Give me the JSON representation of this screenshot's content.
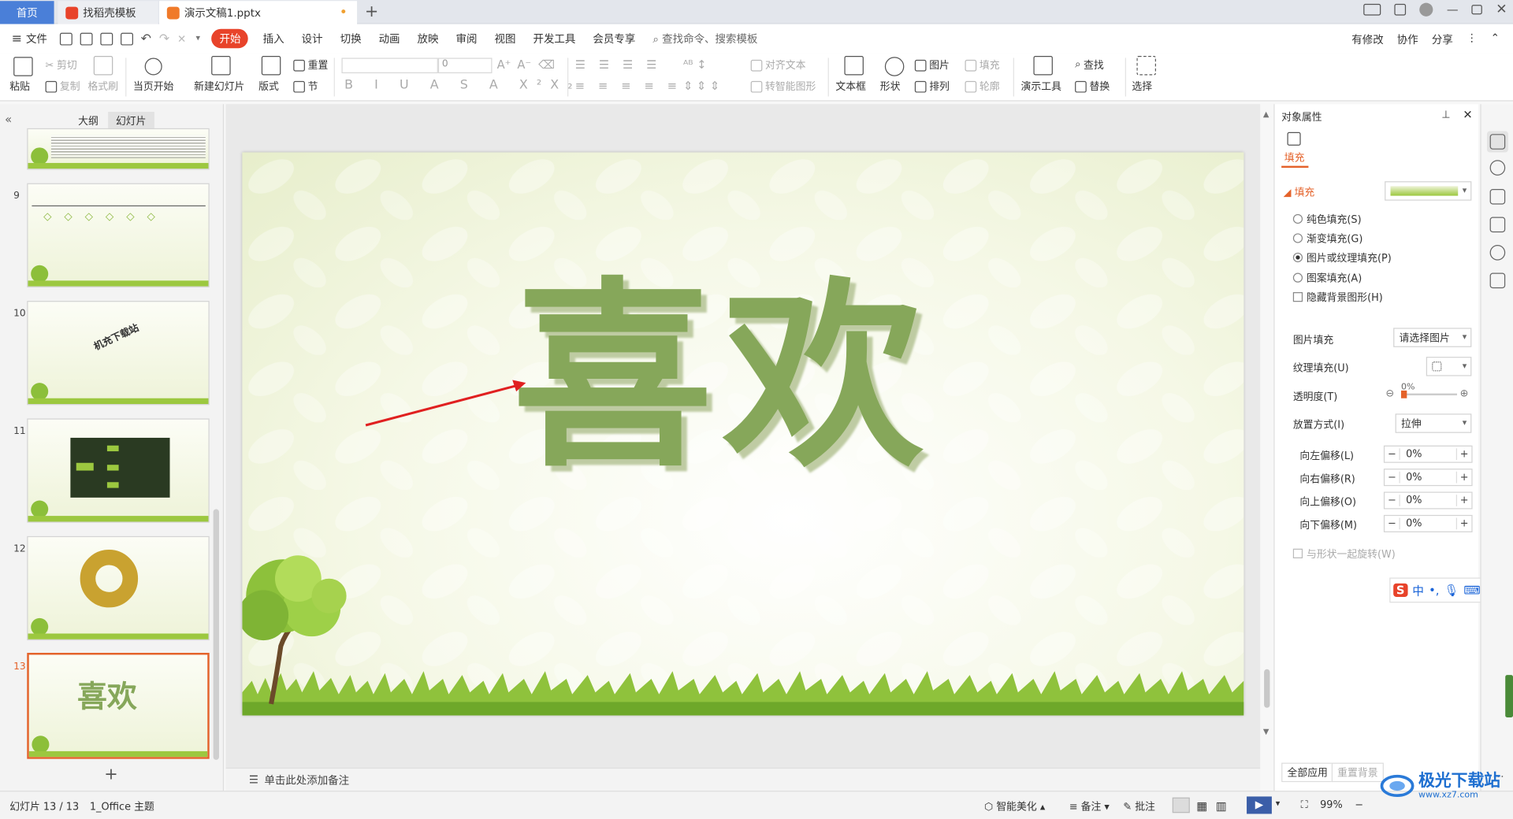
{
  "tabs": {
    "home": "首页",
    "template": "找稻壳模板",
    "doc": "演示文稿1.pptx"
  },
  "menu": {
    "file": "文件",
    "items": [
      "开始",
      "插入",
      "设计",
      "切换",
      "动画",
      "放映",
      "审阅",
      "视图",
      "开发工具",
      "会员专享"
    ],
    "search": "查找命令、搜索模板",
    "right": [
      "有修改",
      "协作",
      "分享"
    ]
  },
  "ribbon": {
    "paste": "粘贴",
    "cut": "剪切",
    "copy": "复制",
    "format_painter": "格式刷",
    "start_from_page": "当页开始",
    "new_slide": "新建幻灯片",
    "layout": "版式",
    "reset": "重置",
    "section": "节",
    "font_size": "0",
    "align_text": "对齐文本",
    "smart_shape": "转智能图形",
    "textbox": "文本框",
    "shape": "形状",
    "picture": "图片",
    "arrange": "排列",
    "fill": "填充",
    "outline": "轮廓",
    "presentation_tools": "演示工具",
    "find": "查找",
    "replace": "替换",
    "select": "选择"
  },
  "left": {
    "tab_outline": "大纲",
    "tab_slides": "幻灯片",
    "thumbs": [
      {
        "num": "",
        "kind": "text"
      },
      {
        "num": "9",
        "kind": "timeline"
      },
      {
        "num": "10",
        "kind": "wordart",
        "text": "机充下载站"
      },
      {
        "num": "11",
        "kind": "mindmap"
      },
      {
        "num": "12",
        "kind": "ring"
      },
      {
        "num": "13",
        "kind": "title",
        "text": "喜欢"
      }
    ],
    "add": "+"
  },
  "slide": {
    "wordart": "喜欢",
    "wordart_color": "#86a75a",
    "arrow_color": "#e02020"
  },
  "notes": {
    "placeholder": "单击此处添加备注"
  },
  "pane": {
    "title": "对象属性",
    "tab_fill": "填充",
    "section": "填充",
    "options": [
      "纯色填充(S)",
      "渐变填充(G)",
      "图片或纹理填充(P)",
      "图案填充(A)"
    ],
    "hide_bg": "隐藏背景图形(H)",
    "pic_fill_label": "图片填充",
    "pic_fill_value": "请选择图片",
    "texture_label": "纹理填充(U)",
    "transparency_label": "透明度(T)",
    "transparency_value": "0%",
    "transparency_fraction": 0,
    "placement_label": "放置方式(I)",
    "placement_value": "拉伸",
    "offsets": [
      {
        "label": "向左偏移(L)",
        "value": "0%"
      },
      {
        "label": "向右偏移(R)",
        "value": "0%"
      },
      {
        "label": "向上偏移(O)",
        "value": "0%"
      },
      {
        "label": "向下偏移(M)",
        "value": "0%"
      }
    ],
    "rotate": "与形状一起旋转(W)",
    "apply_all": "全部应用",
    "reset_bg": "重置背景"
  },
  "status": {
    "slide_pos": "幻灯片 13 / 13",
    "theme": "1_Office 主题",
    "beautify": "智能美化",
    "notes": "备注",
    "comments": "批注",
    "zoom": "99%"
  },
  "ime": {
    "label": "中"
  },
  "watermark": {
    "text": "极光下载站",
    "url": "www.xz7.com"
  }
}
